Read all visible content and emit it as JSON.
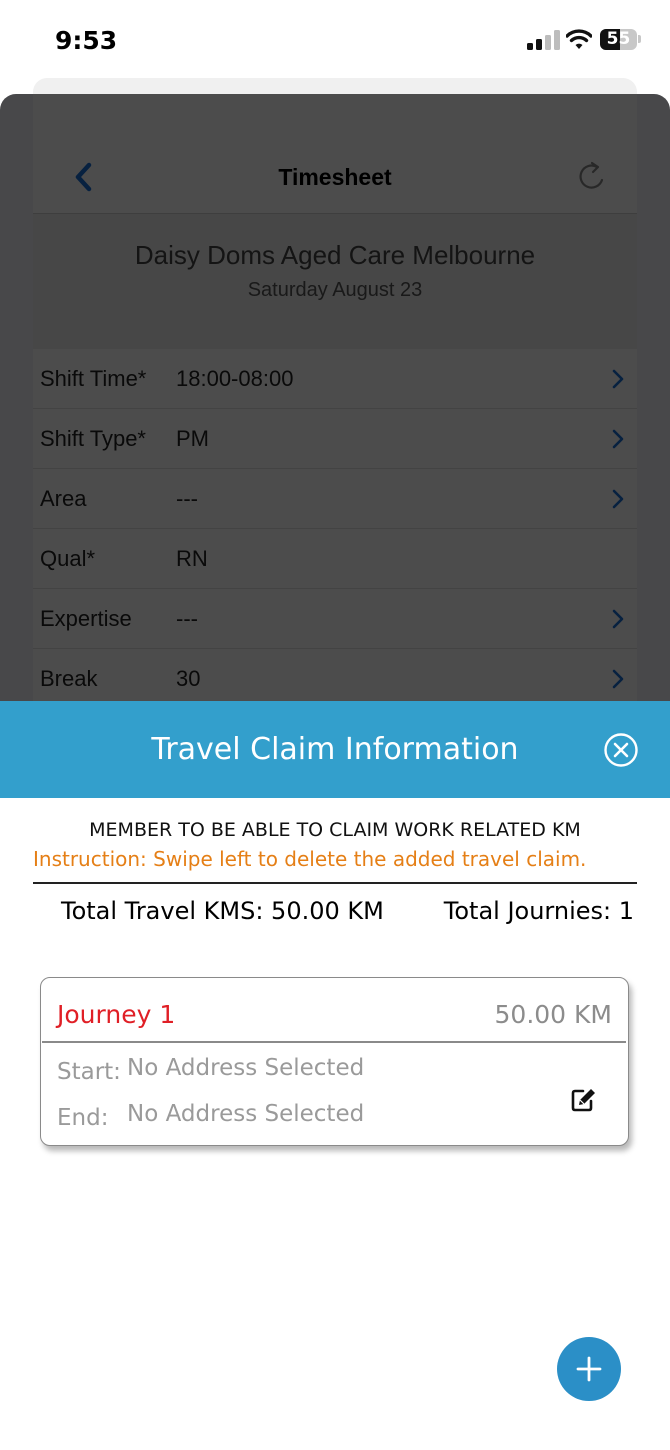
{
  "status_bar": {
    "time": "9:53",
    "battery": "55",
    "battery_level": 0.55
  },
  "timesheet": {
    "title": "Timesheet",
    "facility": "Daisy Doms Aged Care Melbourne",
    "date": "Saturday August 23",
    "rows": [
      {
        "label": "Shift Time*",
        "value": "18:00-08:00",
        "chevron": true
      },
      {
        "label": "Shift Type*",
        "value": "PM",
        "chevron": true
      },
      {
        "label": "Area",
        "value": "---",
        "chevron": true
      },
      {
        "label": "Qual*",
        "value": "RN",
        "chevron": false
      },
      {
        "label": "Expertise",
        "value": "---",
        "chevron": true
      },
      {
        "label": "Break",
        "value": "30",
        "chevron": true
      }
    ]
  },
  "modal": {
    "title": "Travel Claim Information",
    "notice": "MEMBER TO BE ABLE TO CLAIM WORK RELATED KM",
    "instruction": "Instruction: Swipe left to delete the added travel claim.",
    "total_kms": "Total Travel KMS: 50.00 KM",
    "total_journeys": "Total Journies: 1",
    "journeys": [
      {
        "title": "Journey 1",
        "distance": "50.00 KM",
        "start_label": "Start:",
        "start_value": "No Address Selected",
        "end_label": "End:",
        "end_value": "No Address Selected"
      }
    ]
  },
  "colors": {
    "header_blue": "#339fcc",
    "fab_blue": "#2b8fc7",
    "instruction_orange": "#e57f16",
    "journey_red": "#e01f26",
    "ios_blue": "#1a6fd6"
  },
  "icons": [
    "back-chevron-icon",
    "refresh-icon",
    "chevron-right-icon",
    "close-circle-icon",
    "edit-icon",
    "plus-icon",
    "signal-icon",
    "wifi-icon",
    "battery-icon"
  ]
}
